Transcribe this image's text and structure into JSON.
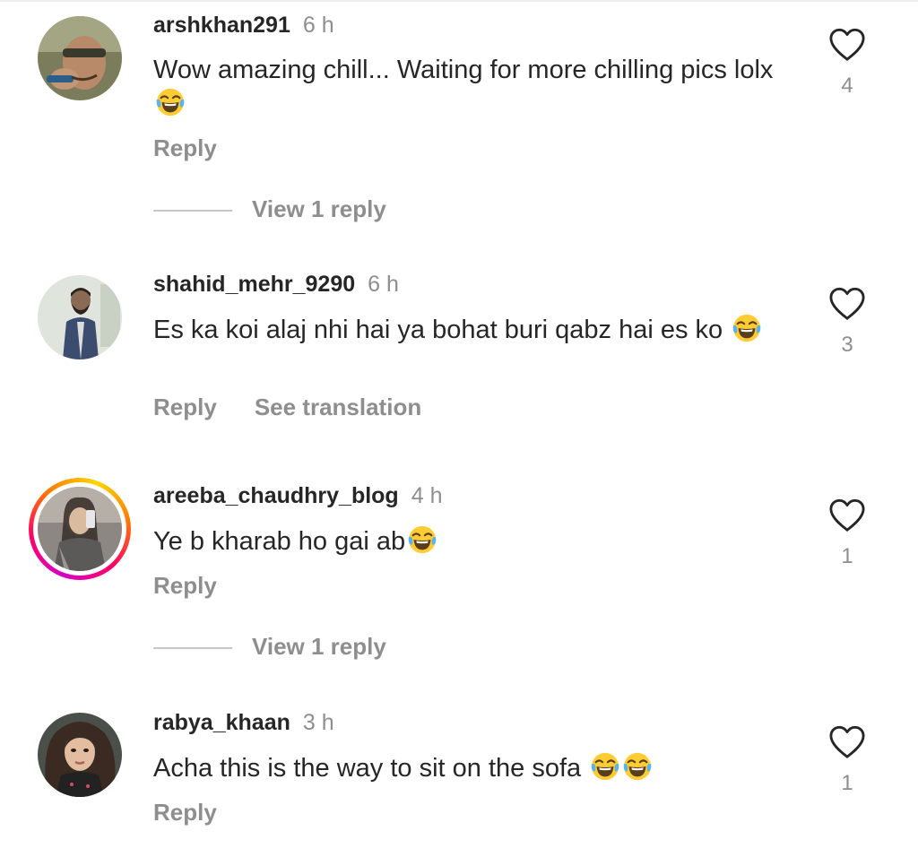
{
  "comments": [
    {
      "username": "arshkhan291",
      "time": "6 h",
      "text": "Wow amazing chill... Waiting for more chilling pics lolx",
      "emojis": [
        "face-with-tears-of-joy"
      ],
      "actions": {
        "reply": "Reply"
      },
      "view_replies": "View 1 reply",
      "likes": "4"
    },
    {
      "username": "shahid_mehr_9290",
      "time": "6 h",
      "text": "Es ka koi alaj nhi hai ya bohat buri qabz hai es ko",
      "emojis": [
        "face-with-tears-of-joy"
      ],
      "actions": {
        "reply": "Reply",
        "translate": "See translation"
      },
      "likes": "3"
    },
    {
      "username": "areeba_chaudhry_blog",
      "time": "4 h",
      "text": "Ye b kharab ho gai ab",
      "emojis": [
        "face-with-tears-of-joy"
      ],
      "has_story": true,
      "actions": {
        "reply": "Reply"
      },
      "view_replies": "View 1 reply",
      "likes": "1"
    },
    {
      "username": "rabya_khaan",
      "time": "3 h",
      "text": "Acha this is the way to sit on the sofa ",
      "emojis": [
        "face-with-tears-of-joy",
        "face-with-tears-of-joy"
      ],
      "actions": {
        "reply": "Reply"
      },
      "likes": "1"
    }
  ],
  "icons": {
    "like": "heart-outline-icon",
    "emoji": "face-with-tears-of-joy"
  },
  "colors": {
    "primary_text": "#262626",
    "secondary_text": "#8e8e8e",
    "divider": "#c7c7c7"
  }
}
